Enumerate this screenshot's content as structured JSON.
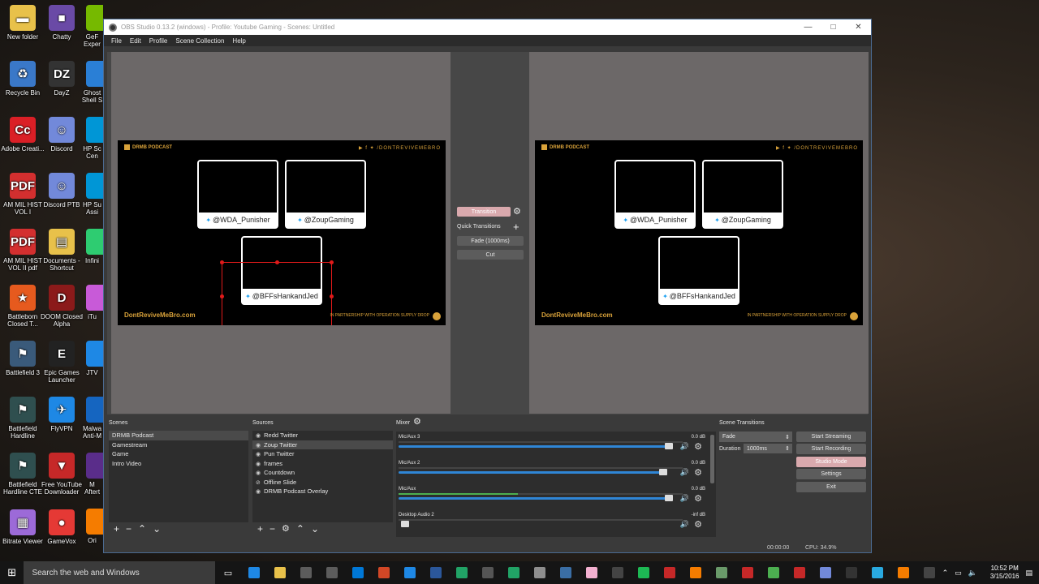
{
  "desktop": {
    "icons": [
      {
        "label": "New folder",
        "glyph": "▬",
        "color": "#e8c14a"
      },
      {
        "label": "Chatty",
        "glyph": "■",
        "color": "#6a4aa6"
      },
      {
        "label": "Recycle Bin",
        "glyph": "♻",
        "color": "#3a78c8"
      },
      {
        "label": "DayZ",
        "glyph": "DZ",
        "color": "#333333"
      },
      {
        "label": "Adobe Creati...",
        "glyph": "Cc",
        "color": "#da1f26"
      },
      {
        "label": "Discord",
        "glyph": "☺",
        "color": "#7289da"
      },
      {
        "label": "AM MIL HIST VOL I",
        "glyph": "PDF",
        "color": "#d32f2f"
      },
      {
        "label": "Discord PTB",
        "glyph": "☺",
        "color": "#7289da"
      },
      {
        "label": "AM MIL HIST VOL II pdf",
        "glyph": "PDF",
        "color": "#d32f2f"
      },
      {
        "label": "Documents - Shortcut",
        "glyph": "▤",
        "color": "#e8c14a"
      },
      {
        "label": "Battleborn Closed T...",
        "glyph": "★",
        "color": "#e65a1e"
      },
      {
        "label": "DOOM Closed Alpha",
        "glyph": "D",
        "color": "#8b1a1a"
      },
      {
        "label": "Battlefield 3",
        "glyph": "⚑",
        "color": "#3a5a7a"
      },
      {
        "label": "Epic Games Launcher",
        "glyph": "E",
        "color": "#222222"
      },
      {
        "label": "Battlefield Hardline",
        "glyph": "⚑",
        "color": "#2f4f4f"
      },
      {
        "label": "FlyVPN",
        "glyph": "✈",
        "color": "#1e88e5"
      },
      {
        "label": "Battlefield Hardline CTE",
        "glyph": "⚑",
        "color": "#2f4f4f"
      },
      {
        "label": "Free YouTube Downloader",
        "glyph": "▼",
        "color": "#c62828"
      },
      {
        "label": "Bitrate Viewer",
        "glyph": "▦",
        "color": "#9c6ad8"
      },
      {
        "label": "GameVox",
        "glyph": "●",
        "color": "#e53935"
      }
    ],
    "partial_icons": [
      {
        "label": "GeF Exper",
        "color": "#76b900"
      },
      {
        "label": "Ghost Shell S",
        "color": "#2a7fd6"
      },
      {
        "label": "HP Sc Cen",
        "color": "#0096d6"
      },
      {
        "label": "HP Su Assi",
        "color": "#0096d6"
      },
      {
        "label": "Infini",
        "color": "#2ecc71"
      },
      {
        "label": "iTu",
        "color": "#c85ad8"
      },
      {
        "label": "JTV",
        "color": "#1e88e5"
      },
      {
        "label": "Malwa Anti-M",
        "color": "#1565c0"
      },
      {
        "label": "M Aftert",
        "color": "#5a2d8a"
      },
      {
        "label": "Ori",
        "color": "#f57c00"
      }
    ]
  },
  "window": {
    "title": "OBS Studio 0.13.2 (windows) - Profile: Youtube Gaming - Scenes: Untitled",
    "controls": [
      "—",
      "□",
      "✕"
    ]
  },
  "menu": [
    "File",
    "Edit",
    "Profile",
    "Scene Collection",
    "Help"
  ],
  "preview": {
    "logo": "DRMB PODCAST",
    "handle": "▶ f ✦ /DONTREVIVEMEBRO",
    "website": "DontReviveMeBro.com",
    "partnership": "IN PARTNERSHIP WITH  OPERATION SUPPLY DROP",
    "cams": [
      "@WDA_Punisher",
      "@ZoupGaming",
      "@BFFsHankandJed"
    ]
  },
  "transition_panel": {
    "transition_label": "Transition",
    "quick_transitions_label": "Quick Transitions",
    "fade_label": "Fade (1000ms)",
    "cut_label": "Cut"
  },
  "scenes": {
    "title": "Scenes",
    "items": [
      "DRMB Podcast",
      "Gamestream",
      "Game",
      "Intro Video"
    ]
  },
  "sources": {
    "title": "Sources",
    "items": [
      "Redd Twitter",
      "Zoup Twitter",
      "Pun Twitter",
      "frames",
      "Countdown",
      "Offline Slide",
      "DRMB Podcast Overlay"
    ]
  },
  "mixer": {
    "title": "Mixer",
    "channels": [
      {
        "name": "Mic/Aux 3",
        "db": "0.0 dB",
        "level": 0.0,
        "volume": 0.97
      },
      {
        "name": "Mic/Aux 2",
        "db": "0.0 dB",
        "level": 0.0,
        "volume": 0.95
      },
      {
        "name": "Mic/Aux",
        "db": "0.0 dB",
        "level": 0.42,
        "volume": 0.97
      },
      {
        "name": "Desktop Audio 2",
        "db": "-inf dB",
        "level": 0.0,
        "volume": 0.02
      }
    ]
  },
  "scene_transitions": {
    "title": "Scene Transitions",
    "selected": "Fade",
    "duration_label": "Duration",
    "duration_value": "1000ms"
  },
  "controls": {
    "start_streaming": "Start Streaming",
    "start_recording": "Start Recording",
    "studio_mode": "Studio Mode",
    "settings": "Settings",
    "exit": "Exit"
  },
  "status": {
    "time": "00:00:00",
    "cpu": "CPU: 34.9%"
  },
  "taskbar": {
    "search_placeholder": "Search the web and Windows",
    "time": "10:52 PM",
    "date": "3/15/2016",
    "apps": [
      "#1e88e5",
      "#e8c14a",
      "#5c5c5c",
      "#5c5c5c",
      "#0078d7",
      "#d24726",
      "#1e88e5",
      "#2b579a",
      "#21a366",
      "#555555",
      "#21a366",
      "#8e8e8e",
      "#3a6ea5",
      "#f3b0d0",
      "#444444",
      "#1db954",
      "#c62828",
      "#f57c00",
      "#6a9a6a",
      "#c62828",
      "#4caf50",
      "#c62828",
      "#7289da",
      "#333333",
      "#29a9e0",
      "#f57c00",
      "#444444"
    ]
  }
}
